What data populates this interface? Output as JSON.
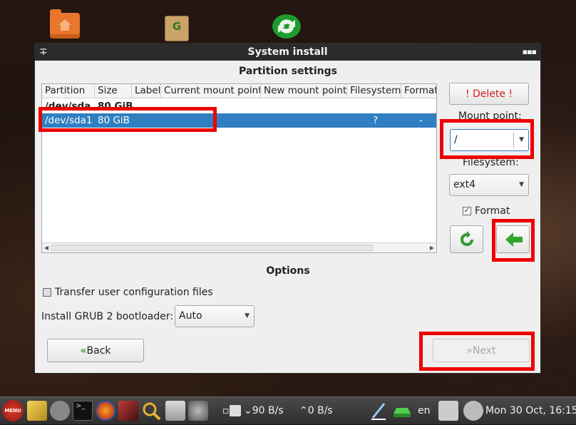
{
  "window": {
    "title": "System install"
  },
  "partition": {
    "section_title": "Partition settings",
    "columns": [
      "Partition",
      "Size",
      "Label",
      "Current mount point",
      "New mount point",
      "Filesystem",
      "Format"
    ],
    "rows": [
      {
        "partition": "/dev/sda",
        "size": "80 GiB",
        "label": "",
        "current": "",
        "new": "",
        "filesystem": "",
        "format": ""
      },
      {
        "partition": "/dev/sda1",
        "size": "80 GiB",
        "label": "",
        "current": "",
        "new": "",
        "filesystem": "?",
        "format": "-",
        "selected": true
      }
    ]
  },
  "right_panel": {
    "delete_label": "! Delete !",
    "mount_point_label": "Mount point:",
    "mount_point_value": "/",
    "filesystem_label": "Filesystem:",
    "filesystem_value": "ext4",
    "format_label": "Format",
    "format_checked": true
  },
  "options": {
    "section_title": "Options",
    "transfer_label": "Transfer user configuration files",
    "grub_label": "Install GRUB 2 bootloader:",
    "grub_value": "Auto"
  },
  "buttons": {
    "back_label": "Back",
    "next_label": "Next"
  },
  "taskbar": {
    "menu_label": "MENU",
    "download_rate": "90 B/s",
    "upload_rate": "0 B/s",
    "keyboard_layout": "en",
    "clock": "Mon 30 Oct, 16:15"
  },
  "colors": {
    "highlight": "#ee0000",
    "selection": "#2f7fc1",
    "delete_text": "#d21f1f",
    "accent_green": "#3aa03a"
  }
}
